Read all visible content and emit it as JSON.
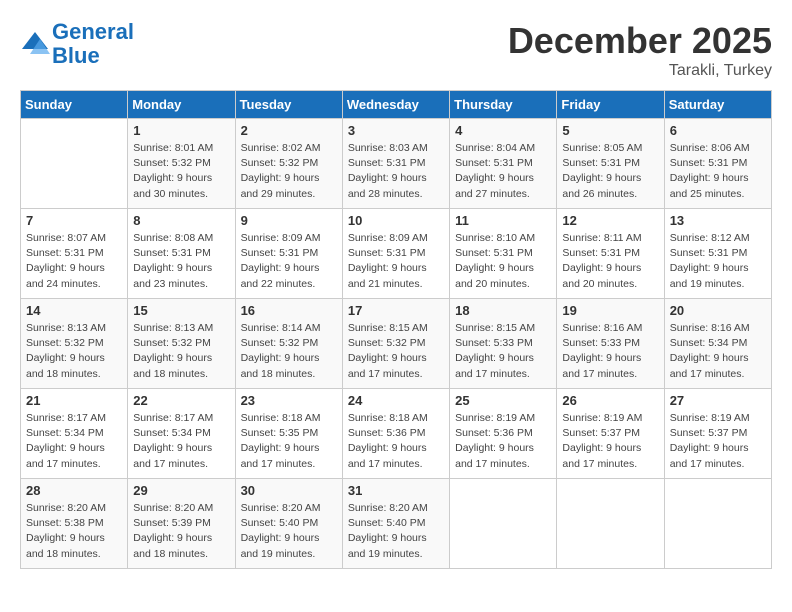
{
  "header": {
    "logo_line1": "General",
    "logo_line2": "Blue",
    "month": "December 2025",
    "location": "Tarakli, Turkey"
  },
  "weekdays": [
    "Sunday",
    "Monday",
    "Tuesday",
    "Wednesday",
    "Thursday",
    "Friday",
    "Saturday"
  ],
  "weeks": [
    [
      {
        "day": "",
        "info": ""
      },
      {
        "day": "1",
        "info": "Sunrise: 8:01 AM\nSunset: 5:32 PM\nDaylight: 9 hours\nand 30 minutes."
      },
      {
        "day": "2",
        "info": "Sunrise: 8:02 AM\nSunset: 5:32 PM\nDaylight: 9 hours\nand 29 minutes."
      },
      {
        "day": "3",
        "info": "Sunrise: 8:03 AM\nSunset: 5:31 PM\nDaylight: 9 hours\nand 28 minutes."
      },
      {
        "day": "4",
        "info": "Sunrise: 8:04 AM\nSunset: 5:31 PM\nDaylight: 9 hours\nand 27 minutes."
      },
      {
        "day": "5",
        "info": "Sunrise: 8:05 AM\nSunset: 5:31 PM\nDaylight: 9 hours\nand 26 minutes."
      },
      {
        "day": "6",
        "info": "Sunrise: 8:06 AM\nSunset: 5:31 PM\nDaylight: 9 hours\nand 25 minutes."
      }
    ],
    [
      {
        "day": "7",
        "info": "Sunrise: 8:07 AM\nSunset: 5:31 PM\nDaylight: 9 hours\nand 24 minutes."
      },
      {
        "day": "8",
        "info": "Sunrise: 8:08 AM\nSunset: 5:31 PM\nDaylight: 9 hours\nand 23 minutes."
      },
      {
        "day": "9",
        "info": "Sunrise: 8:09 AM\nSunset: 5:31 PM\nDaylight: 9 hours\nand 22 minutes."
      },
      {
        "day": "10",
        "info": "Sunrise: 8:09 AM\nSunset: 5:31 PM\nDaylight: 9 hours\nand 21 minutes."
      },
      {
        "day": "11",
        "info": "Sunrise: 8:10 AM\nSunset: 5:31 PM\nDaylight: 9 hours\nand 20 minutes."
      },
      {
        "day": "12",
        "info": "Sunrise: 8:11 AM\nSunset: 5:31 PM\nDaylight: 9 hours\nand 20 minutes."
      },
      {
        "day": "13",
        "info": "Sunrise: 8:12 AM\nSunset: 5:31 PM\nDaylight: 9 hours\nand 19 minutes."
      }
    ],
    [
      {
        "day": "14",
        "info": "Sunrise: 8:13 AM\nSunset: 5:32 PM\nDaylight: 9 hours\nand 18 minutes."
      },
      {
        "day": "15",
        "info": "Sunrise: 8:13 AM\nSunset: 5:32 PM\nDaylight: 9 hours\nand 18 minutes."
      },
      {
        "day": "16",
        "info": "Sunrise: 8:14 AM\nSunset: 5:32 PM\nDaylight: 9 hours\nand 18 minutes."
      },
      {
        "day": "17",
        "info": "Sunrise: 8:15 AM\nSunset: 5:32 PM\nDaylight: 9 hours\nand 17 minutes."
      },
      {
        "day": "18",
        "info": "Sunrise: 8:15 AM\nSunset: 5:33 PM\nDaylight: 9 hours\nand 17 minutes."
      },
      {
        "day": "19",
        "info": "Sunrise: 8:16 AM\nSunset: 5:33 PM\nDaylight: 9 hours\nand 17 minutes."
      },
      {
        "day": "20",
        "info": "Sunrise: 8:16 AM\nSunset: 5:34 PM\nDaylight: 9 hours\nand 17 minutes."
      }
    ],
    [
      {
        "day": "21",
        "info": "Sunrise: 8:17 AM\nSunset: 5:34 PM\nDaylight: 9 hours\nand 17 minutes."
      },
      {
        "day": "22",
        "info": "Sunrise: 8:17 AM\nSunset: 5:34 PM\nDaylight: 9 hours\nand 17 minutes."
      },
      {
        "day": "23",
        "info": "Sunrise: 8:18 AM\nSunset: 5:35 PM\nDaylight: 9 hours\nand 17 minutes."
      },
      {
        "day": "24",
        "info": "Sunrise: 8:18 AM\nSunset: 5:36 PM\nDaylight: 9 hours\nand 17 minutes."
      },
      {
        "day": "25",
        "info": "Sunrise: 8:19 AM\nSunset: 5:36 PM\nDaylight: 9 hours\nand 17 minutes."
      },
      {
        "day": "26",
        "info": "Sunrise: 8:19 AM\nSunset: 5:37 PM\nDaylight: 9 hours\nand 17 minutes."
      },
      {
        "day": "27",
        "info": "Sunrise: 8:19 AM\nSunset: 5:37 PM\nDaylight: 9 hours\nand 17 minutes."
      }
    ],
    [
      {
        "day": "28",
        "info": "Sunrise: 8:20 AM\nSunset: 5:38 PM\nDaylight: 9 hours\nand 18 minutes."
      },
      {
        "day": "29",
        "info": "Sunrise: 8:20 AM\nSunset: 5:39 PM\nDaylight: 9 hours\nand 18 minutes."
      },
      {
        "day": "30",
        "info": "Sunrise: 8:20 AM\nSunset: 5:40 PM\nDaylight: 9 hours\nand 19 minutes."
      },
      {
        "day": "31",
        "info": "Sunrise: 8:20 AM\nSunset: 5:40 PM\nDaylight: 9 hours\nand 19 minutes."
      },
      {
        "day": "",
        "info": ""
      },
      {
        "day": "",
        "info": ""
      },
      {
        "day": "",
        "info": ""
      }
    ]
  ]
}
